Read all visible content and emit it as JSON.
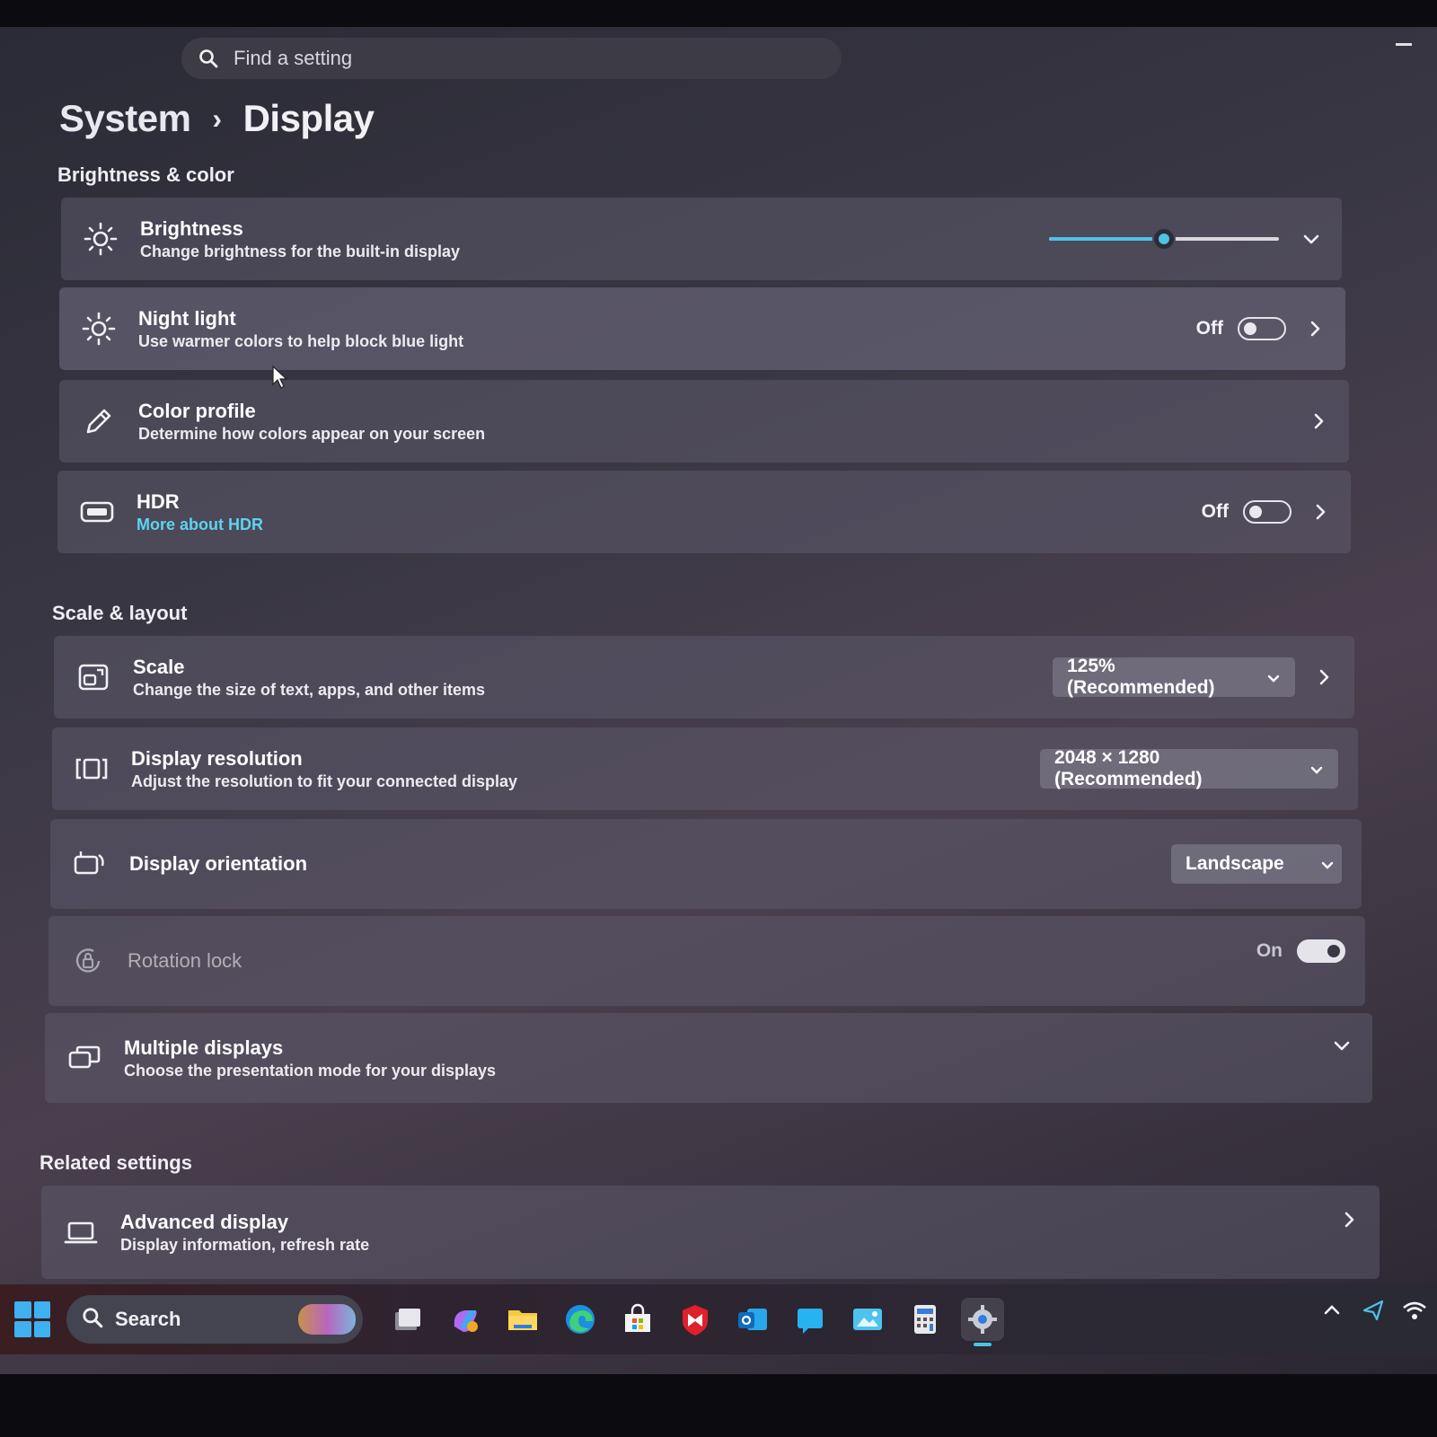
{
  "search": {
    "placeholder": "Find a setting"
  },
  "breadcrumb": {
    "parent": "System",
    "separator": "›",
    "current": "Display"
  },
  "sections": {
    "brightness_color": "Brightness & color",
    "scale_layout": "Scale & layout",
    "related": "Related settings"
  },
  "brightness": {
    "title": "Brightness",
    "subtitle": "Change brightness for the built-in display",
    "level_fraction": 0.5
  },
  "night_light": {
    "title": "Night light",
    "subtitle": "Use warmer colors to help block blue light",
    "state": "Off"
  },
  "color_profile": {
    "title": "Color profile",
    "subtitle": "Determine how colors appear on your screen"
  },
  "hdr": {
    "title": "HDR",
    "link": "More about HDR",
    "state": "Off"
  },
  "scale": {
    "title": "Scale",
    "subtitle": "Change the size of text, apps, and other items",
    "value": "125% (Recommended)"
  },
  "resolution": {
    "title": "Display resolution",
    "subtitle": "Adjust the resolution to fit your connected display",
    "value": "2048 × 1280 (Recommended)"
  },
  "orientation": {
    "title": "Display orientation",
    "value": "Landscape"
  },
  "rotation_lock": {
    "title": "Rotation lock",
    "state": "On"
  },
  "multiple_displays": {
    "title": "Multiple displays",
    "subtitle": "Choose the presentation mode for your displays"
  },
  "advanced_display": {
    "title": "Advanced display",
    "subtitle": "Display information, refresh rate"
  },
  "taskbar": {
    "search_label": "Search",
    "apps": [
      "task-view-icon",
      "copilot-icon",
      "file-explorer-icon",
      "edge-icon",
      "microsoft-store-icon",
      "mcafee-icon",
      "outlook-icon",
      "chat-icon",
      "photos-icon",
      "calculator-icon",
      "settings-icon"
    ],
    "tray": [
      "chevron-up-icon",
      "send-icon",
      "wifi-icon"
    ]
  },
  "colors": {
    "accent": "#4cc2e6",
    "link": "#5ed3f0",
    "card": "#5c5a6c"
  }
}
